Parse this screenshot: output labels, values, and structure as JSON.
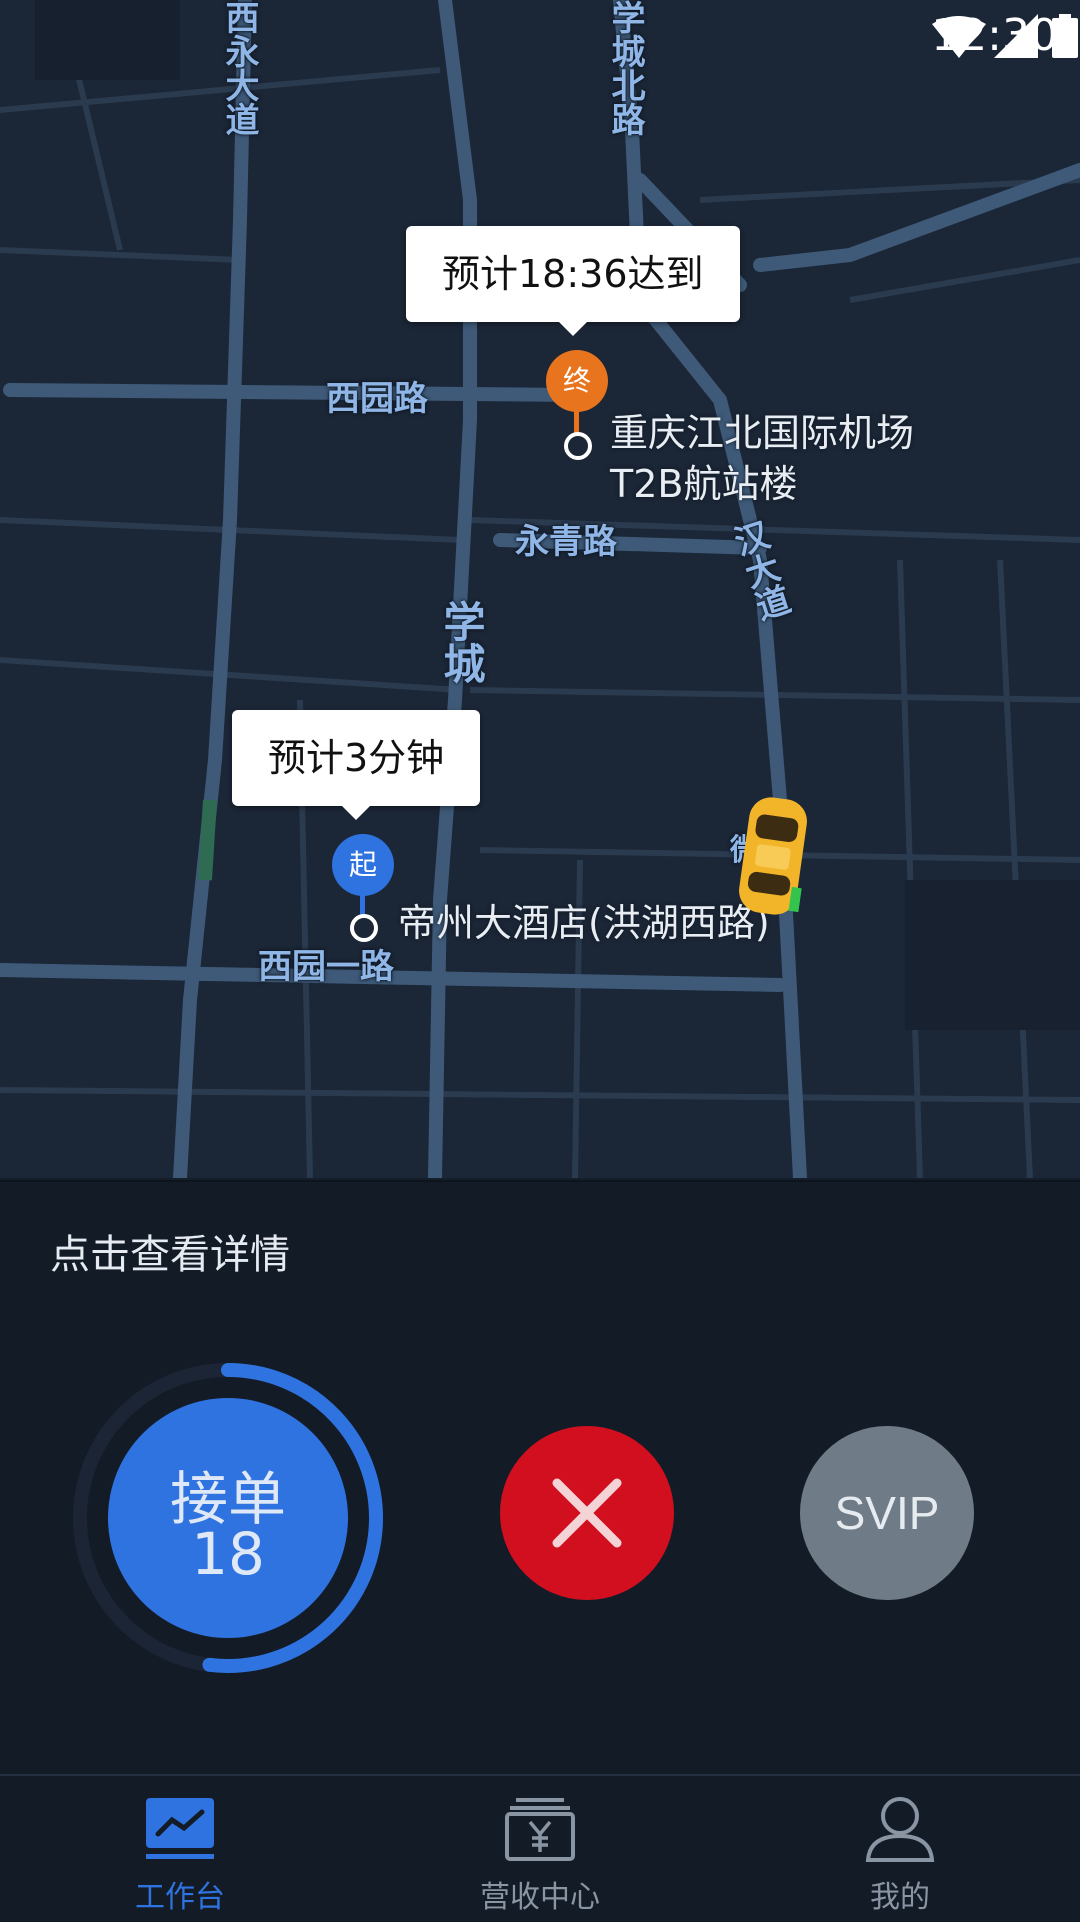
{
  "status_bar": {
    "time": "12:30"
  },
  "map": {
    "road_labels": {
      "xiyong": "西永大道",
      "xuecheng_north": "学城北路",
      "xiyuan": "西园路",
      "yongqing": "永青路",
      "xuecheng": "学城",
      "handa": "汉大道",
      "xiyuan_one": "西园一路",
      "wei_yuan": "微园"
    },
    "destination": {
      "eta": "预计18:36达到",
      "badge": "终",
      "name_line1": "重庆江北国际机场",
      "name_line2": "T2B航站楼"
    },
    "pickup": {
      "eta": "预计3分钟",
      "badge": "起",
      "name": "帝州大酒店(洪湖西路)"
    },
    "car_icon": "taxi-car-icon"
  },
  "details": {
    "label": "点击查看详情"
  },
  "actions": {
    "accept_label": "接单",
    "accept_count": "18",
    "accept_progress": 0.52,
    "reject_icon": "close-x-icon",
    "svip_label": "SVIP"
  },
  "tabs": [
    {
      "label": "工作台",
      "icon": "workbench-chart-icon",
      "active": true
    },
    {
      "label": "营收中心",
      "icon": "revenue-yen-icon",
      "active": false
    },
    {
      "label": "我的",
      "icon": "profile-person-icon",
      "active": false
    }
  ],
  "colors": {
    "accent": "#2f73e0",
    "reject": "#d10f1f",
    "svip": "#6f7b87",
    "destination_pin": "#e8741e",
    "pickup_pin": "#2f73e0"
  }
}
